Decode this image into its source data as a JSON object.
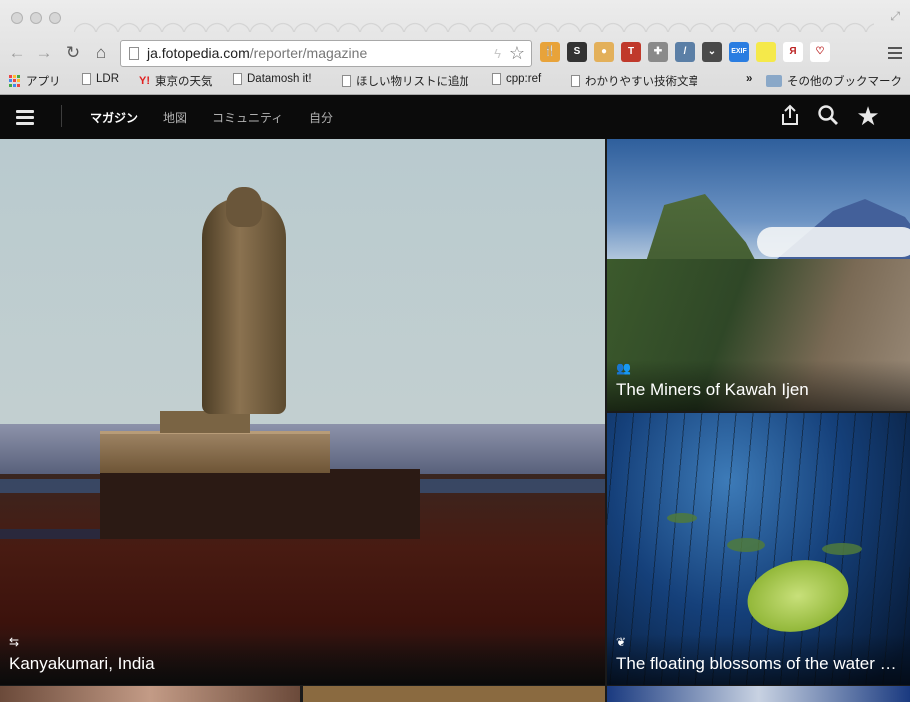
{
  "browser": {
    "url_host": "ja.fotopedia.com",
    "url_path": "/reporter/magazine",
    "extensions": [
      {
        "name": "fork-knife-icon",
        "color": "#e8a33a",
        "label": "🍴"
      },
      {
        "name": "s-extension-icon",
        "color": "#333333",
        "label": "S"
      },
      {
        "name": "cookie-icon",
        "color": "#e3b05a",
        "label": "●"
      },
      {
        "name": "t-extension-icon",
        "color": "#c0392b",
        "label": "T"
      },
      {
        "name": "puzzle-icon",
        "color": "#8a8a8a",
        "label": "✚"
      },
      {
        "name": "eyedropper-icon",
        "color": "#5b7fa6",
        "label": "/"
      },
      {
        "name": "pocket-icon",
        "color": "#4a4a4a",
        "label": "⌄"
      },
      {
        "name": "exif-icon",
        "color": "#2a7de1",
        "label": "EXIF"
      },
      {
        "name": "sticky-note-icon",
        "color": "#f5e94a",
        "label": ""
      },
      {
        "name": "ya-icon",
        "color": "#ffffff",
        "label": "Я"
      },
      {
        "name": "heart-icon",
        "color": "#ffffff",
        "label": "♡"
      }
    ]
  },
  "bookmarks": [
    {
      "label": "アプリ",
      "type": "apps"
    },
    {
      "label": "LDR",
      "type": "doc"
    },
    {
      "label": "東京の天気",
      "type": "yahoo"
    },
    {
      "label": "Datamosh it!",
      "type": "doc"
    },
    {
      "label": "ほしい物リストに追加",
      "type": "doc"
    },
    {
      "label": "cpp:ref",
      "type": "doc"
    },
    {
      "label": "わかりやすい技術文章",
      "type": "doc"
    }
  ],
  "bookmarks_overflow": "»",
  "bookmarks_other": "その他のブックマーク",
  "site_nav": {
    "tabs": [
      "マガジン",
      "地図",
      "コミュニティ",
      "自分"
    ]
  },
  "tiles": {
    "main": {
      "title": "Kanyakumari, India",
      "icon": "signpost-icon"
    },
    "top_right": {
      "title": "The Miners of Kawah Ijen",
      "icon": "people-icon"
    },
    "bottom_right": {
      "title": "The floating blossoms of the water lily ...",
      "icon": "crane-icon"
    }
  }
}
